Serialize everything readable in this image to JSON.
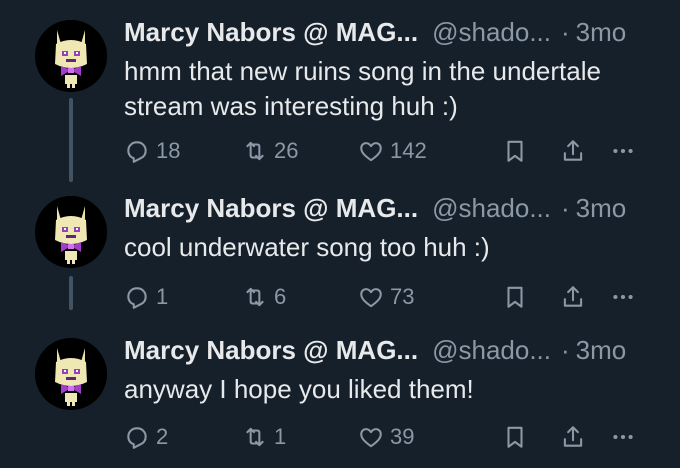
{
  "tweets": [
    {
      "name": "Marcy Nabors @ MAG...",
      "handle": "@shado...",
      "separator": "·",
      "time": "3mo",
      "text": "hmm that new ruins song in the undertale stream was interesting huh :)",
      "replies": "18",
      "retweets": "26",
      "likes": "142"
    },
    {
      "name": "Marcy Nabors @ MAG...",
      "handle": "@shado...",
      "separator": "·",
      "time": "3mo",
      "text": "cool underwater song too huh :)",
      "replies": "1",
      "retweets": "6",
      "likes": "73"
    },
    {
      "name": "Marcy Nabors @ MAG...",
      "handle": "@shado...",
      "separator": "·",
      "time": "3mo",
      "text": "anyway I hope you liked them!",
      "replies": "2",
      "retweets": "1",
      "likes": "39"
    }
  ],
  "icons": {
    "reply": "reply-icon",
    "retweet": "retweet-icon",
    "like": "heart-icon",
    "bookmark": "bookmark-icon",
    "share": "share-icon",
    "more": "more-icon"
  },
  "colors": {
    "background": "#15202b",
    "text": "#e7e9ea",
    "secondary": "#8b98a5",
    "thread_line": "#425364"
  }
}
